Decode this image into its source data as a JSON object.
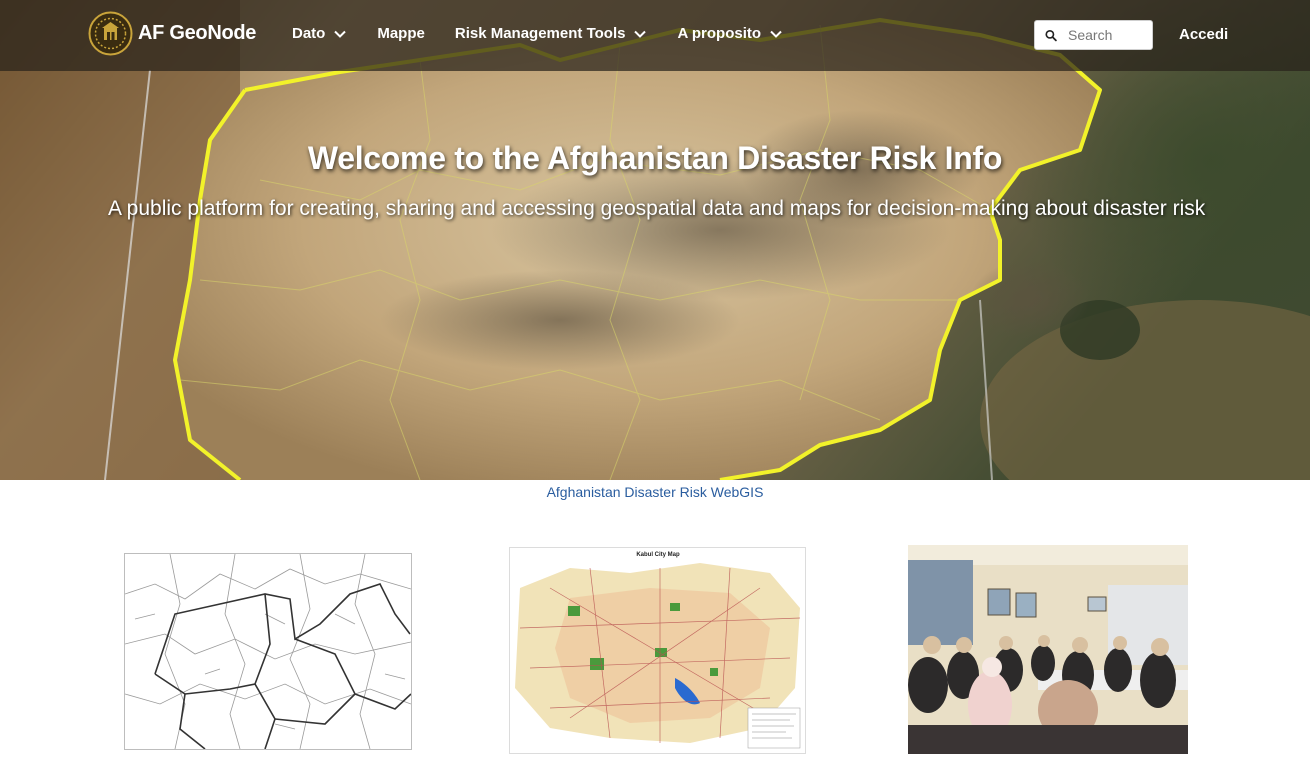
{
  "header": {
    "brand_name": "AF GeoNode",
    "nav": [
      {
        "label": "Dato",
        "has_dropdown": true
      },
      {
        "label": "Mappe",
        "has_dropdown": false
      },
      {
        "label": "Risk Management Tools",
        "has_dropdown": true
      },
      {
        "label": "A proposito",
        "has_dropdown": true
      }
    ],
    "search": {
      "placeholder": "Search",
      "value": "",
      "icon": "search-icon"
    },
    "login_label": "Accedi"
  },
  "hero": {
    "title": "Welcome to the Afghanistan Disaster Risk Info",
    "subtitle": "A public platform for creating, sharing and accessing geospatial data and maps for decision-making about disaster risk"
  },
  "webgis_link": "Afghanistan Disaster Risk WebGIS",
  "cards": [
    {
      "name": "admin-boundaries-map-thumbnail"
    },
    {
      "name": "kabul-city-map-thumbnail",
      "map_title": "Kabul City Map"
    },
    {
      "name": "meeting-photo-thumbnail"
    }
  ],
  "colors": {
    "header_bg": "#28221a",
    "link": "#2a5d9f",
    "border_highlight": "#f2f22a"
  }
}
